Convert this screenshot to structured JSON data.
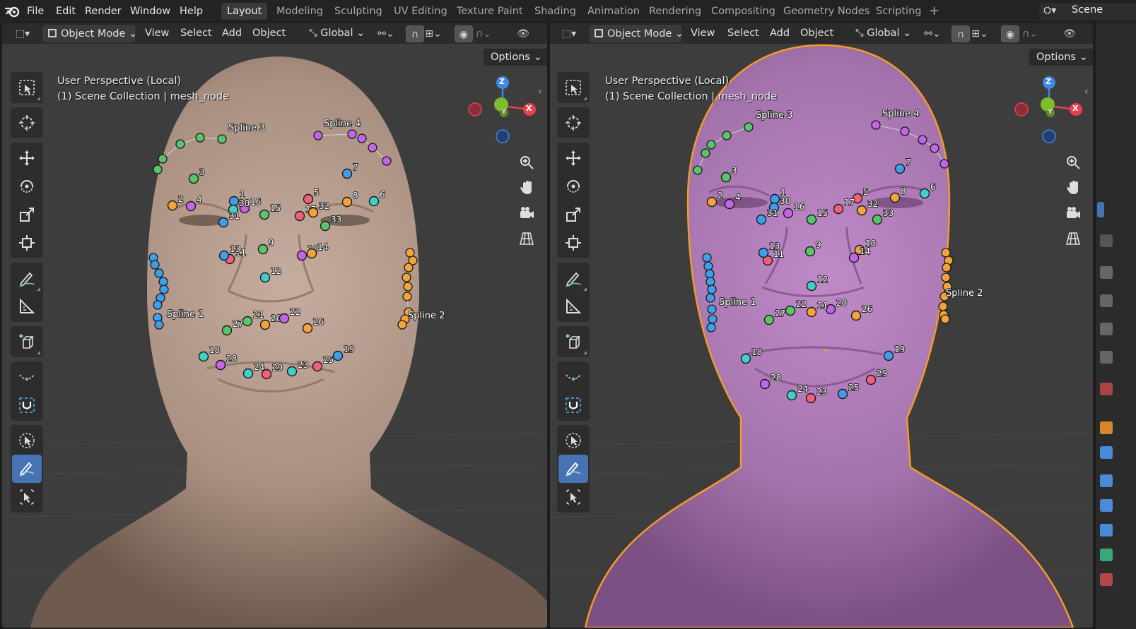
{
  "topbar": {
    "menus": [
      "File",
      "Edit",
      "Render",
      "Window",
      "Help"
    ],
    "workspaces": [
      "Layout",
      "Modeling",
      "Sculpting",
      "UV Editing",
      "Texture Paint",
      "Shading",
      "Animation",
      "Rendering",
      "Compositing",
      "Geometry Nodes",
      "Scripting"
    ],
    "active_workspace": "Layout",
    "add_tab": "+",
    "scene_label": "Scene"
  },
  "viewport_header": {
    "mode": "Object Mode",
    "menus": [
      "View",
      "Select",
      "Add",
      "Object"
    ],
    "orientation": "Global",
    "options": "Options"
  },
  "viewport_left": {
    "perspective": "User Perspective (Local)",
    "collection": "(1) Scene Collection | mesh_node"
  },
  "viewport_right": {
    "perspective": "User Perspective (Local)",
    "collection": "(1) Scene Collection | mesh_node"
  },
  "gizmo": {
    "z": "Z",
    "y": "Y",
    "x": "X"
  },
  "splines": [
    "Spline 1",
    "Spline 2",
    "Spline 3",
    "Spline 4"
  ],
  "landmark_labels": [
    "1",
    "2",
    "3",
    "4",
    "5",
    "6",
    "7",
    "8",
    "9",
    "10",
    "11",
    "12",
    "13",
    "14",
    "15",
    "16",
    "17",
    "18",
    "19",
    "20",
    "21",
    "22",
    "23",
    "24",
    "25",
    "26",
    "27",
    "28",
    "29",
    "30",
    "31",
    "32",
    "33"
  ],
  "colors": {
    "accent_blue": "#4772b3",
    "selection_outline": "#f39a2c",
    "skin_left": "#b59b8c",
    "skin_right": "#b07cb8",
    "landmark_blue": "#3f9eea",
    "landmark_orange": "#f2a43a",
    "landmark_green": "#5ac46a",
    "landmark_purple": "#c265e8",
    "landmark_pink": "#f0607a",
    "landmark_cyan": "#3fd0c9"
  }
}
